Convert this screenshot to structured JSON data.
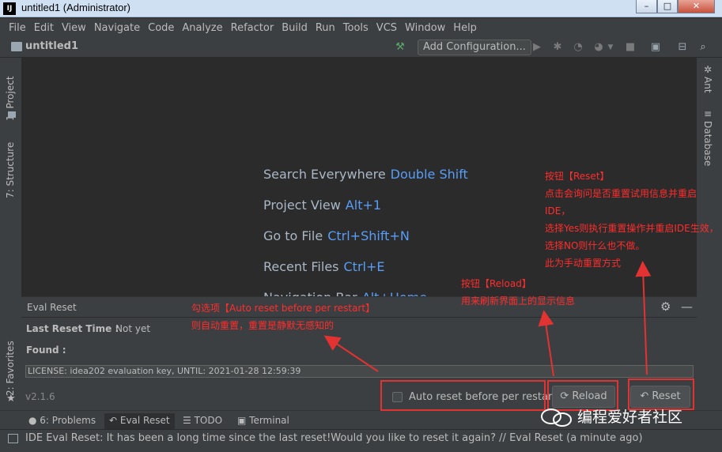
{
  "window": {
    "title": "untitled1 (Administrator)",
    "app_icon": "IJ",
    "minimize": "–",
    "maximize": "□",
    "close": "✕"
  },
  "menu": [
    "File",
    "Edit",
    "View",
    "Navigate",
    "Code",
    "Analyze",
    "Refactor",
    "Build",
    "Run",
    "Tools",
    "VCS",
    "Window",
    "Help"
  ],
  "navbar": {
    "project": "untitled1",
    "add_config": "Add Configuration..."
  },
  "left_tabs": {
    "project": "1: Project",
    "structure": "7: Structure",
    "favorites": "2: Favorites"
  },
  "right_tabs": {
    "ant": "Ant",
    "database": "Database"
  },
  "welcome": [
    {
      "label": "Search Everywhere",
      "key": "Double Shift"
    },
    {
      "label": "Project View",
      "key": "Alt+1"
    },
    {
      "label": "Go to File",
      "key": "Ctrl+Shift+N"
    },
    {
      "label": "Recent Files",
      "key": "Ctrl+E"
    },
    {
      "label": "Navigation Bar",
      "key": "Alt+Home"
    }
  ],
  "panel": {
    "title": "Eval Reset",
    "last_reset_label": "Last Reset Time :",
    "last_reset_value": "Not yet",
    "found_label": "Found :",
    "license_line": "LICENSE: idea202 evaluation key, UNTIL: 2021-01-28 12:59:39",
    "version": "v2.1.6",
    "auto_reset_label": "Auto reset before per restart",
    "reload_label": "Reload",
    "reset_label": "Reset"
  },
  "tool_tabs": {
    "problems": "6: Problems",
    "eval_reset": "Eval Reset",
    "todo": "TODO",
    "terminal": "Terminal"
  },
  "status": {
    "message": "IDE Eval Reset: It has been a long time since the last reset!Would you like to reset it again? // Eval Reset (a minute ago)"
  },
  "annotations": {
    "reset_lines": [
      "按钮【Reset】",
      "点击会询问是否重置试用信息并重启IDE，",
      "选择Yes则执行重置操作并重启IDE生效，",
      "选择NO则什么也不做。",
      "此为手动重置方式"
    ],
    "reload_lines": [
      "按钮【Reload】",
      "用来刷新界面上的显示信息"
    ],
    "auto_lines": [
      "勾选项【Auto reset before per restart】",
      "则自动重置，重置是静默无感知的"
    ]
  },
  "watermark": "编程爱好者社区",
  "colors": {
    "accent": "#589df6",
    "annotation": "#ff2d2d",
    "background": "#2b2b2b",
    "panel": "#3c3f41"
  }
}
